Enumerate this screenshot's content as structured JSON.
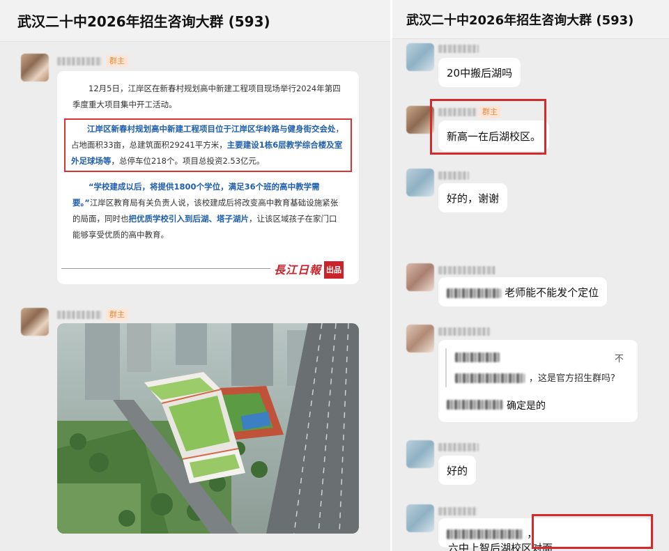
{
  "left": {
    "title": "武汉二十中2026年招生咨询大群 (593)",
    "messages": [
      {
        "badge": "群主",
        "article": {
          "p1": "12月5日，江岸区在新春村规划高中新建工程项目现场举行2024年第四季度重大项目集中开工活动。",
          "p2_hl1": "江岸区新春村规划高中新建工程项目位于江岸区华岭路与健身街交会处",
          "p2_t1": "，占地面积33亩，总建筑面积29241平方米，",
          "p2_hl2": "主要建设1栋6层教学综合楼及室外足球场等",
          "p2_t2": "，总停车位218个。项目总投资2.53亿元。",
          "p3_hl1": "“学校建成以后，将提供1800个学位，满足36个班的高中教学需要。”",
          "p3_t1": "江岸区教育局有关负责人说，该校建成后将改变高中教育基础设施紧张的局面，同时也",
          "p3_hl2": "把优质学校引入到后湖、塔子湖片",
          "p3_t2": "，让该区域孩子在家门口能够享受优质的高中教育。",
          "logo_text": "長江日報",
          "logo_box": "出品"
        }
      },
      {
        "badge": "群主",
        "image": "school-rendering-photo"
      }
    ]
  },
  "right": {
    "title": "武汉二十中2026年招生咨询大群 (593)",
    "messages": [
      {
        "text": "20中搬后湖吗"
      },
      {
        "badge": "群主",
        "text": "新高一在后湖校区。"
      },
      {
        "text": "好的，谢谢"
      },
      {
        "text": "老师能不能发个定位"
      },
      {
        "quote_close": "不",
        "quote_text": "，这是官方招生群吗?",
        "text": "确定是的"
      },
      {
        "text": "好的"
      },
      {
        "text": "六中上智后湖校区对面",
        "prefix": "，"
      }
    ]
  },
  "colors": {
    "highlight_red": "#d62a2a",
    "badge_orange": "#f08a3b",
    "link_blue": "#1f5fae"
  }
}
